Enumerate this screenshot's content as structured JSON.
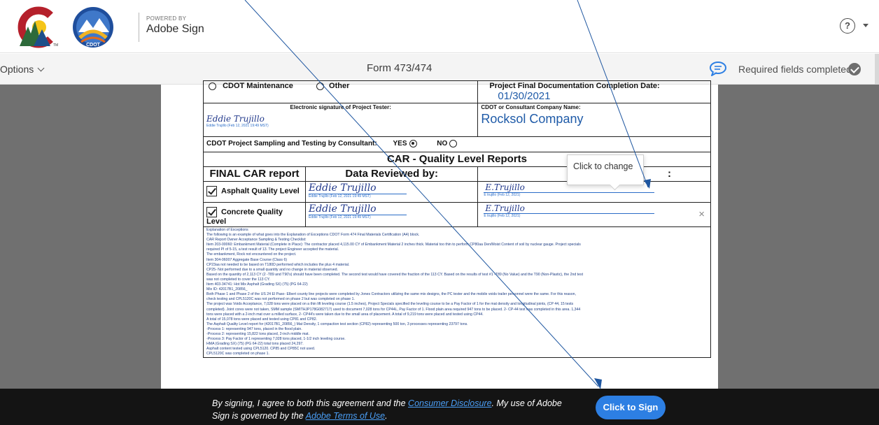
{
  "header": {
    "powered_by": "POWERED BY",
    "product": "Adobe Sign",
    "logo_text": "CDOT",
    "logo_mark": "TM"
  },
  "toolbar": {
    "options_label": "Options",
    "form_title": "Form 473/474",
    "required_status": "Required fields completed"
  },
  "document": {
    "maintenance_label": "CDOT Maintenance",
    "other_label": "Other",
    "completion_label": "Project Final Documentation Completion Date:",
    "completion_date": "01/30/2021",
    "esig_label": "Electronic signature of Project Tester:",
    "company_label": "CDOT or Consultant Company Name:",
    "company_name": "Rocksol Company",
    "tester_sig": "Eddie Trujillo",
    "tester_sig_sub": "Eddie Trujillo (Feb 12, 2021 19:49 MST)",
    "sampling_label": "CDOT Project Sampling and Testing by Consultant:",
    "yes_label": "YES",
    "no_label": "NO",
    "section_title": "CAR - Quality Level Reports",
    "col_final": "FINAL CAR report",
    "col_reviewed": "Data Reviewed by:",
    "col_third_partial": "",
    "col_third_end": ":",
    "row1_label": "Asphalt Quality Level",
    "row1_sig": "Eddie Trujillo",
    "row1_sig_sub": "Eddie Trujillo (Feb 12, 2021 19:49 MST)",
    "row1_sig2": "E.Trujillo",
    "row1_sig2_sub": "E trujillo (Feb 12, 2021)",
    "row2_label": "Concrete Quality Level",
    "row2_sig": "Eddie Trujillo",
    "row2_sig_sub": "Eddie Trujillo (Feb 12, 2021 19:49 MST)",
    "row2_sig2": "E.Trujillo",
    "row2_sig2_sub": "E trujillo (Feb 12, 2021)",
    "clear_symbol": "×",
    "explanation": [
      "Explanation of Exceptions",
      "The following is an example of what goes into the Explanation of Exceptions CDOT Form 474 Final Materials Certification (A4) block.",
      "CAR Report Owner Acceptance Sampling & Testing Checklist:",
      "Item 203-00060: Embankment Material (Complete in Place): The contractor placed 4,115.00 CY of Embankment Material 2 inches thick. Material too thin to perform CP80aa Den/Moist Content of soil by nuclear gauge. Project specials",
      "required PI of 5-15, a test result of 13. The project Engineer accepted the material.",
      "The embankment, Rock not encountered on the project.",
      "Item 304-06007 Aggregate Base Course (Class 6)",
      "CP23aa not needed to be based on T180D performed which includes the plus 4 material.",
      "CP25- Not performed due to a small quantity and no change in material observed.",
      "Based on the quantity of 2,113 CY (2 -T89 and T90's) should have been completed. The second test would have covered the fraction of the 113 CY. Based on the results of test #1 -T89 (No Value) and the T90 (Non-Plastic), the 2nd test",
      "was not completed to cover the 113 CY.",
      "Item 403-34741: Hot Mix Asphalt (Grading SX) (75) (PG 64-22)",
      "Mix ID: 42017B1_20856_",
      "Both Phase 1 and Phase 2 of the US 24 El Paso- Elbert county line projects were completed by Jones Contractors utilizing the same mix designs, the PC tester and the mobile voids trailer personnel were the same. For this reason,",
      "check testing and CPL5120C was not performed on phase 2 but was completed on phase 1.",
      "The project was Voids Acceptance, 7,028 tons were placed on a thin lift leveling course (1.5 inches), Project Specials specified the leveling course to be a Pay Factor of 1 for the mat density and longitudinal joints, (CP 44, 15 tests",
      "completed). Joint cores were not taken, SMM sample (SMITHJP178G082717) used to document 7,028 tons for CP44L, Pay Factor of 1. Flood plain area required 947 tons to be placed. 2- CP-44 test was completed in this area. 1,344",
      "tons were placed with a 2-inch mat over a milled surface, 2- CP44's were taken due to the small area of placement. A total of 9,219 tons were placed and tested using CP44.",
      "A total of 15,078 tons were placed and tested using CP81 and CP82.",
      "The Asphalt Quality Level report for (42017B1_20856_) Mat Density, 1 compaction test section (CP82) representing 500 ton, 3 processes representing 23797 tons.",
      "-Process 1: representing 947 tons, placed in the flood plain.",
      "-Process 2: representing 15,822 tons placed, 2-inch middle mat.",
      "-Process 3: Pay Factor of 1 representing 7,028 tons placed, 1-1/2 inch leveling course.",
      "HMA (Grading SX) (75) (PG 64-22) total tons placed 24,297.",
      "Asphalt content tested using CPL5120. CP85 and CP85C not used.",
      "CPL5120C was completed on phase 1."
    ]
  },
  "tooltip": {
    "text": "Click to change"
  },
  "footer": {
    "agree_pre": "By signing, I agree to both this agreement and the ",
    "consumer_link": "Consumer Disclosure",
    "agree_mid": ". My use of Adobe Sign is governed by the ",
    "terms_link": "Adobe Terms of Use",
    "agree_post": ".",
    "sign_button": "Click to Sign"
  },
  "colors": {
    "accent": "#2d7fe3",
    "footer_bg": "#141414",
    "viewer_bg": "#707070",
    "link": "#4a9ef5",
    "annotation_line": "#1e56a0"
  },
  "icons": [
    "colorado-c-logo-icon",
    "cdot-logo-icon",
    "help-icon",
    "chevron-down-icon",
    "comment-icon",
    "check-circle-icon",
    "close-icon"
  ]
}
